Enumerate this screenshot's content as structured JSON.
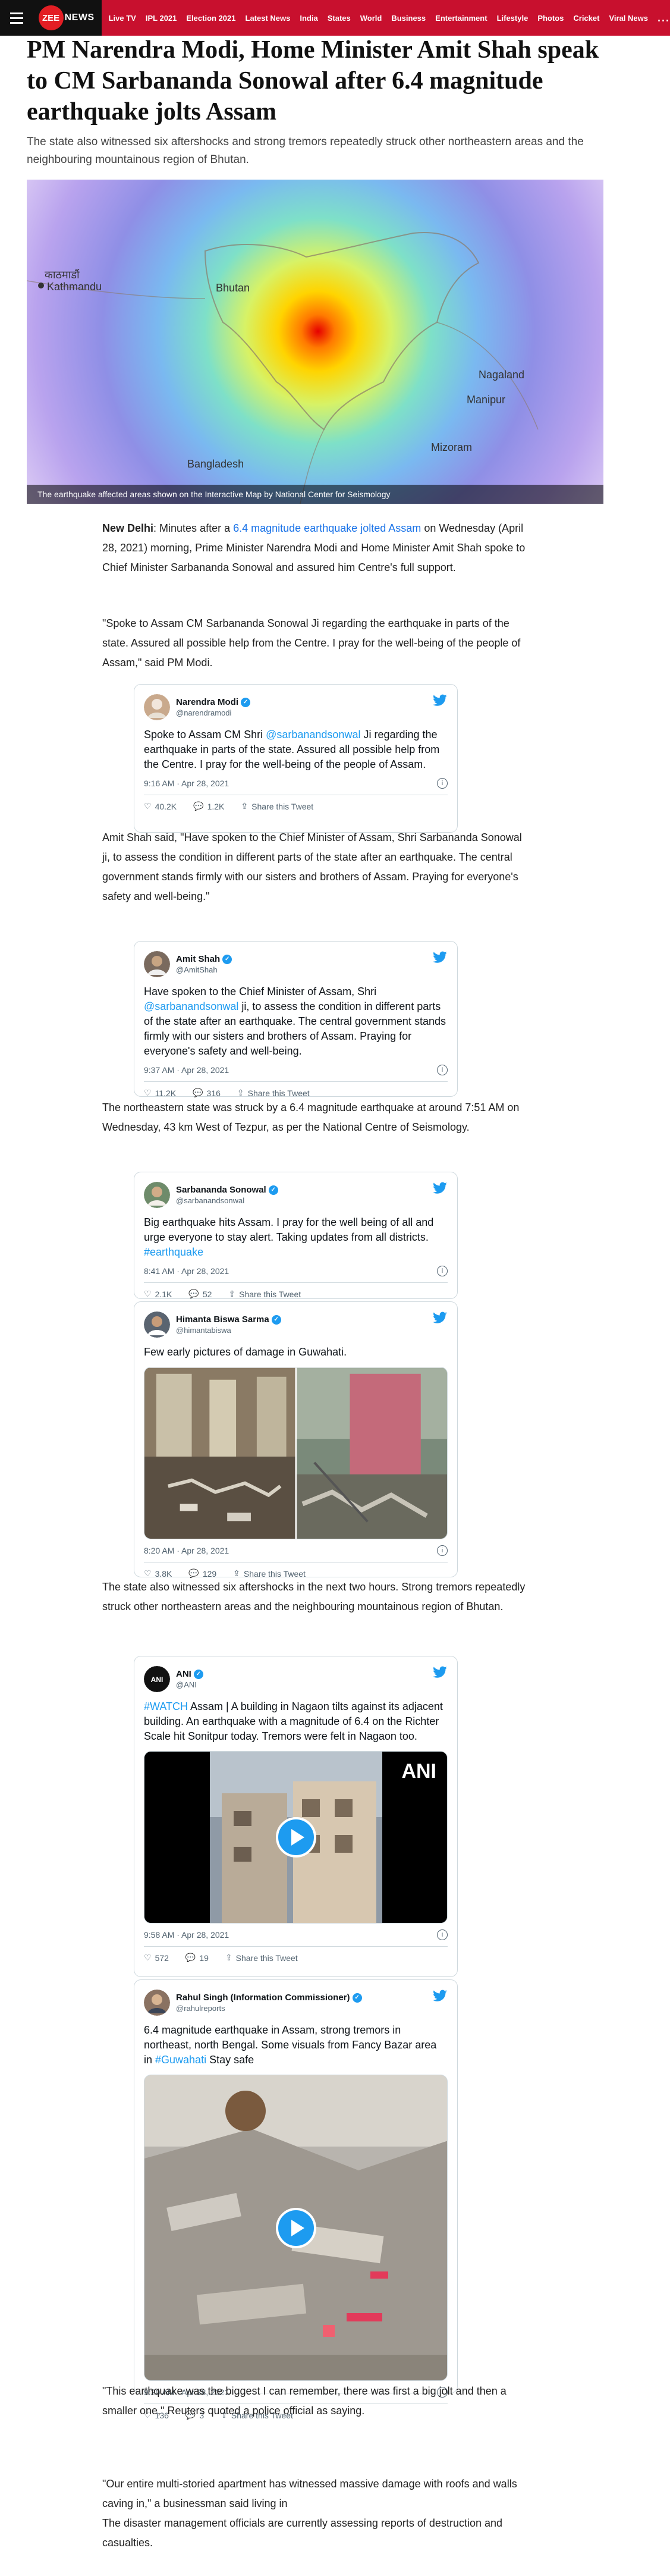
{
  "nav": {
    "logo_main": "ZEE",
    "logo_news": "NEWS",
    "items": [
      "Live TV",
      "IPL 2021",
      "Election 2021",
      "Latest News",
      "India",
      "States",
      "World",
      "Business",
      "Entertainment",
      "Lifestyle",
      "Photos",
      "Cricket",
      "Viral News"
    ],
    "more": "..."
  },
  "article": {
    "headline": "PM Narendra Modi, Home Minister Amit Shah speak to CM Sarbananda Sonowal after 6.4 magnitude earthquake jolts Assam",
    "subhead": "The state also witnessed six aftershocks and strong tremors repeatedly struck other northeastern areas and the neighbouring mountainous region of Bhutan.",
    "hero_caption": "The earthquake affected areas shown on the Interactive Map by National Center for Seismology",
    "map_labels": {
      "kathmandu_np": "काठमाडौं",
      "kathmandu": "Kathmandu",
      "bhutan": "Bhutan",
      "bangladesh": "Bangladesh",
      "nagaland": "Nagaland",
      "manipur": "Manipur",
      "mizoram": "Mizoram"
    },
    "p1_dateline": "New Delhi",
    "p1_pre": ": Minutes after a ",
    "p1_link": "6.4 magnitude earthquake jolted Assam",
    "p1_post": " on Wednesday (April 28, 2021) morning, Prime Minister Narendra Modi and Home Minister Amit Shah spoke to Chief Minister Sarbananda Sonowal and assured him Centre's full support.",
    "p2": "\"Spoke to Assam CM Sarbananda Sonowal Ji regarding the earthquake in parts of the state. Assured all possible help from the Centre. I pray for the well-being of the people of Assam,\" said PM Modi.",
    "p3": "Amit Shah said, \"Have spoken to the Chief Minister of Assam, Shri Sarbananda Sonowal ji, to assess the condition in different parts of the state after an earthquake. The central government stands firmly with our sisters and brothers of Assam. Praying for everyone's safety and well-being.\"",
    "p4": "The northeastern state was struck by a 6.4 magnitude earthquake at around 7:51 AM on Wednesday, 43 km West of Tezpur, as per the National Centre of Seismology.",
    "p5": "The state also witnessed six aftershocks in the next two hours. Strong tremors repeatedly struck other northeastern areas and the neighbouring mountainous region of Bhutan.",
    "p6": "\"This earthquake was the biggest I can remember, there was first a big jolt and then a smaller one,\" Reuters quoted a police official as saying.",
    "p7a": "\"Our entire multi-storied apartment has witnessed massive damage with roofs and walls caving in,\" a businessman said living in",
    "p7b": "The disaster management officials are currently assessing reports of destruction and casualties."
  },
  "tweets": {
    "modi": {
      "name": "Narendra Modi",
      "handle": "@narendramodi",
      "text_pre": "Spoke to Assam CM Shri ",
      "mention": "@sarbanandsonwal",
      "text_post": " Ji regarding the earthquake in parts of the state. Assured all possible help from the Centre. I pray for the well-being of the people of Assam.",
      "time": "9:16 AM · Apr 28, 2021",
      "likes": "40.2K",
      "replies": "1.2K",
      "share": "Share this Tweet"
    },
    "shah": {
      "name": "Amit Shah",
      "handle": "@AmitShah",
      "text_pre": "Have spoken to the Chief Minister of Assam, Shri ",
      "mention": "@sarbanandsonwal",
      "text_post": " ji, to assess the condition in different parts of the state after an earthquake. The central government stands firmly with our sisters and brothers of Assam. Praying for everyone's safety and well-being.",
      "time": "9:37 AM · Apr 28, 2021",
      "likes": "11.2K",
      "replies": "316",
      "share": "Share this Tweet"
    },
    "sonowal": {
      "name": "Sarbananda Sonowal",
      "handle": "@sarbanandsonwal",
      "text": "Big earthquake hits Assam. I pray for the well being of all and urge everyone to stay alert. Taking updates from all districts.",
      "hashtag": "#earthquake",
      "time": "8:41 AM · Apr 28, 2021",
      "likes": "2.1K",
      "replies": "52",
      "share": "Share this Tweet"
    },
    "himanta": {
      "name": "Himanta Biswa Sarma",
      "handle": "@himantabiswa",
      "text": "Few early pictures of damage in Guwahati.",
      "time": "8:20 AM · Apr 28, 2021",
      "likes": "3.8K",
      "replies": "129",
      "share": "Share this Tweet"
    },
    "ani": {
      "name": "ANI",
      "handle": "@ANI",
      "hashtag": "#WATCH",
      "text": " Assam | A building in Nagaon tilts against its adjacent building. An earthquake with a magnitude of 6.4 on the Richter Scale hit Sonitpur today. Tremors were felt in Nagaon too.",
      "watermark": "ANI",
      "time": "9:58 AM · Apr 28, 2021",
      "likes": "572",
      "replies": "19",
      "share": "Share this Tweet"
    },
    "rahul": {
      "name": "Rahul Singh (Information Commissioner)",
      "handle": "@rahulreports",
      "text_pre": "6.4 magnitude earthquake in Assam, strong tremors in northeast, north Bengal. Some visuals from Fancy Bazar area in ",
      "hashtag": "#Guwahati",
      "text_post": " Stay safe",
      "time": "9:20 AM · Apr 28, 2021",
      "likes": "136",
      "replies": "3",
      "share": "Share this Tweet"
    }
  },
  "colors": {
    "nav_red": "#c8102e",
    "twitter_blue": "#1d9bf0",
    "link_blue": "#1a73e8"
  }
}
